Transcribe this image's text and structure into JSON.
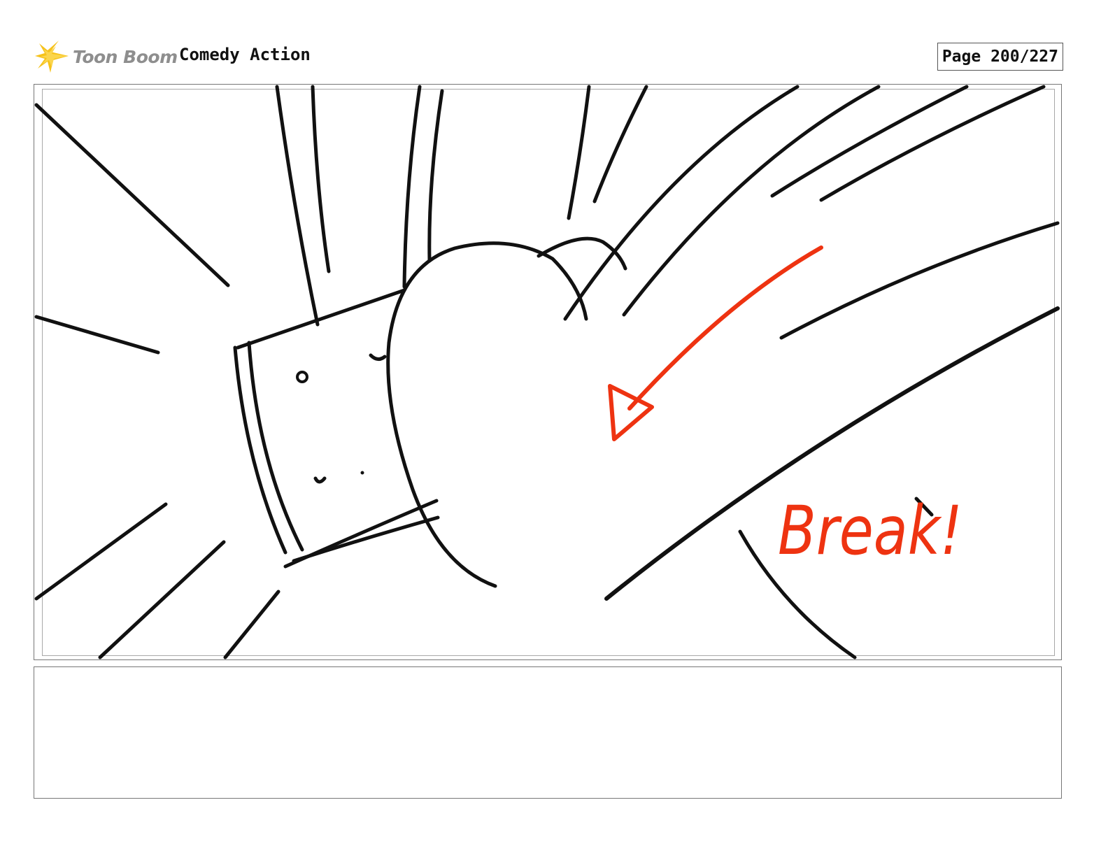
{
  "header": {
    "logo_text": "Toon Boom",
    "project_title": "Comedy Action",
    "page_label": "Page 200/227"
  },
  "panel": {
    "annotation": "Break!",
    "annotation_color": "#ee3311"
  },
  "colors": {
    "logo_burst": "#f6c21a",
    "logo_text": "#8e8e8e",
    "ink": "#111111"
  },
  "icons": {
    "logo": "starburst-icon"
  },
  "notes": {
    "text": ""
  }
}
